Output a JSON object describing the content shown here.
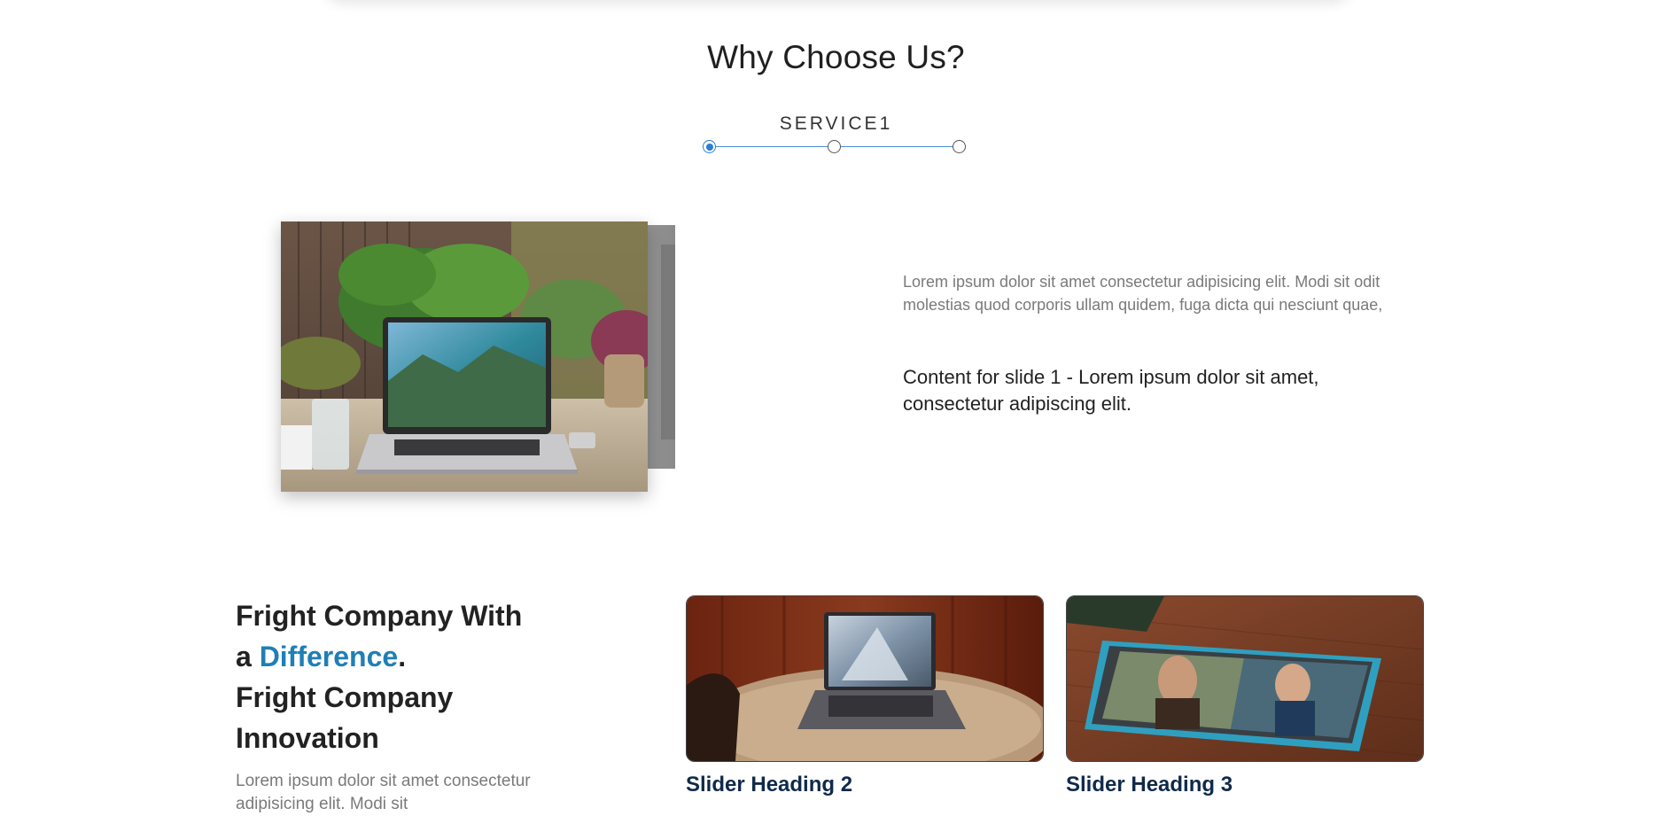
{
  "why": {
    "title": "Why Choose Us?",
    "service_label": "SERVICE1",
    "steps": [
      "step-1",
      "step-2",
      "step-3"
    ],
    "active_step": 1
  },
  "slide": {
    "description": "Lorem ipsum dolor sit amet consectetur adipisicing elit. Modi sit odit molestias quod corporis ullam quidem, fuga dicta qui nesciunt quae,",
    "content": "Content for slide 1 - Lorem ipsum dolor sit amet, consectetur adipiscing elit."
  },
  "fright": {
    "line1": "Fright Company With",
    "line2_prefix": "a ",
    "line2_accent": "Difference",
    "line2_suffix": ".",
    "line3": "Fright Company",
    "line4": "Innovation",
    "description": "Lorem ipsum dolor sit amet consectetur adipisicing elit. Modi sit"
  },
  "cards": [
    {
      "title": "Slider Heading 2"
    },
    {
      "title": "Slider Heading 3"
    }
  ],
  "colors": {
    "accent": "#1f7fb6",
    "step_active": "#2f7bd8",
    "card_title": "#0f2a4a"
  }
}
